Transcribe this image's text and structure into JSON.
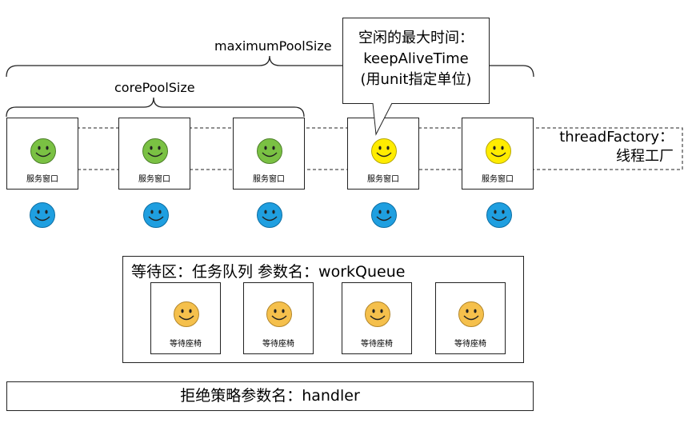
{
  "labels": {
    "maximum_pool_size": "maximumPoolSize",
    "core_pool_size": "corePoolSize"
  },
  "callout": {
    "line1": "空闲的最大时间：",
    "line2": "keepAliveTime",
    "line3": "(用unit指定单位)"
  },
  "thread_factory": {
    "line1": "threadFactory：",
    "line2": "线程工厂"
  },
  "windows": [
    {
      "label": "服务窗口",
      "worker": "green"
    },
    {
      "label": "服务窗口",
      "worker": "green"
    },
    {
      "label": "服务窗口",
      "worker": "green"
    },
    {
      "label": "服务窗口",
      "worker": "yellow"
    },
    {
      "label": "服务窗口",
      "worker": "yellow"
    }
  ],
  "queue": {
    "title": "等待区：任务队列 参数名：workQueue",
    "seats": [
      {
        "label": "等待座椅"
      },
      {
        "label": "等待座椅"
      },
      {
        "label": "等待座椅"
      },
      {
        "label": "等待座椅"
      }
    ]
  },
  "handler": {
    "title": "拒绝策略参数名：handler"
  },
  "colors": {
    "core_worker": "#7ac143",
    "extra_worker": "#ffec00",
    "customer": "#1f9fe0",
    "waiting": "#f5c04c"
  }
}
